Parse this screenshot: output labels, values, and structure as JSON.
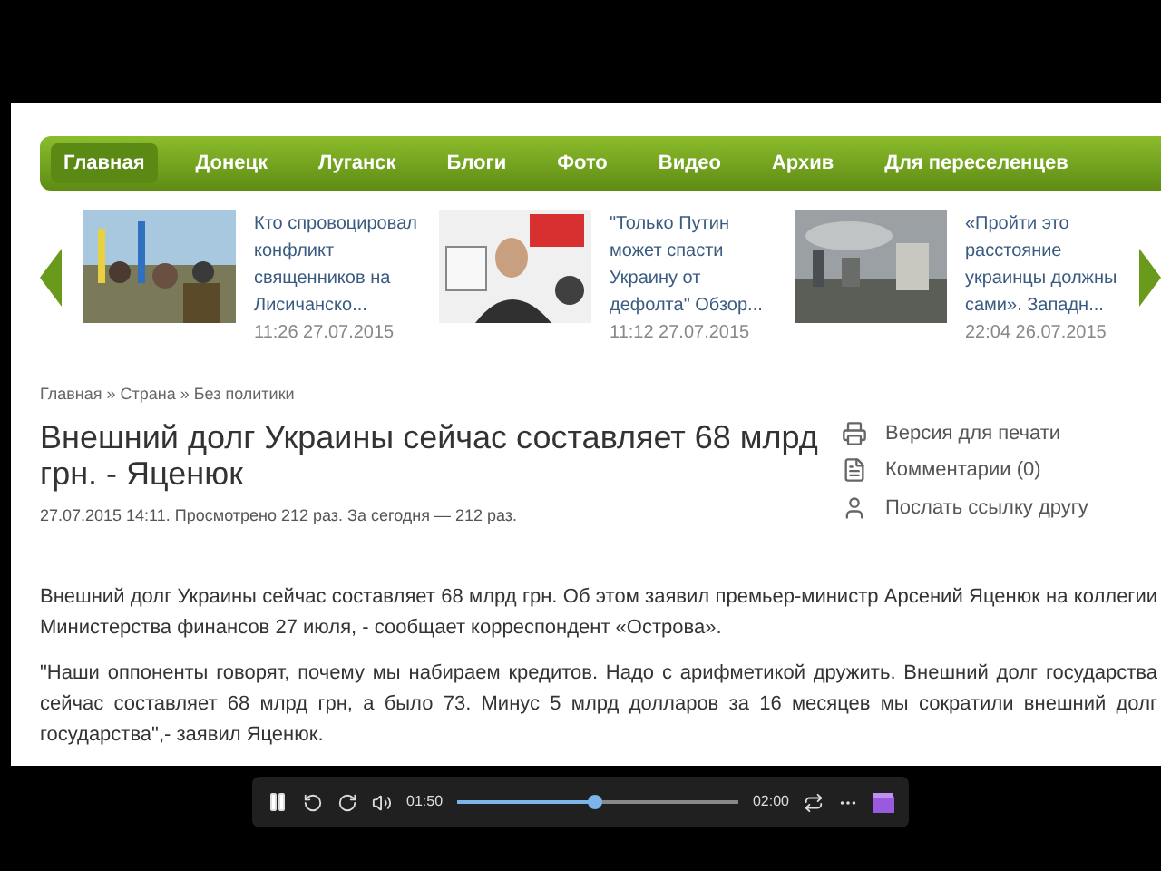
{
  "nav": [
    {
      "label": "Главная",
      "selected": true
    },
    {
      "label": "Донецк",
      "selected": false
    },
    {
      "label": "Луганск",
      "selected": false
    },
    {
      "label": "Блоги",
      "selected": false
    },
    {
      "label": "Фото",
      "selected": false
    },
    {
      "label": "Видео",
      "selected": false
    },
    {
      "label": "Архив",
      "selected": false
    },
    {
      "label": "Для переселенцев",
      "selected": false
    }
  ],
  "news": [
    {
      "title": "Кто спровоцировал конфликт священников на Лисичанско...",
      "time": "11:26 27.07.2015",
      "kind": "picture"
    },
    {
      "title": "\"Только Путин может спасти Украину от дефолта\" Обзор...",
      "time": "11:12 27.07.2015",
      "kind": "picture"
    },
    {
      "title": "«Пройти это расстояние украинцы должны сами». Западн...",
      "time": "22:04 26.07.2015",
      "kind": "picture"
    }
  ],
  "breadcrumb": "Главная » Страна » Без политики",
  "article": {
    "title": "Внешний долг Украины сейчас составляет 68 млрд грн. - Яценюк",
    "meta": "27.07.2015 14:11. Просмотрено 212 раз. За сегодня — 212 раз.",
    "paragraphs": [
      "Внешний долг Украины сейчас составляет 68 млрд грн. Об этом заявил премьер-министр Арсений Яценюк на коллегии Министерства финансов 27 июля, - сообщает корреспондент «Острова».",
      "\"Наши оппоненты говорят, почему мы набираем кредитов. Надо с арифметикой дружить. Внешний долг государства сейчас составляет 68 млрд грн, а было 73. Минус 5 млрд долларов за 16 месяцев мы сократили внешний долг государства\",- заявил Яценюк."
    ]
  },
  "tools": [
    {
      "label": "Версия для печати",
      "kind": "print"
    },
    {
      "label": "Комментарии (0)",
      "kind": "comments"
    },
    {
      "label": "Послать ссылку другу",
      "kind": "send"
    }
  ],
  "player": {
    "elapsed": "01:50",
    "total": "02:00",
    "level": 0.49
  }
}
